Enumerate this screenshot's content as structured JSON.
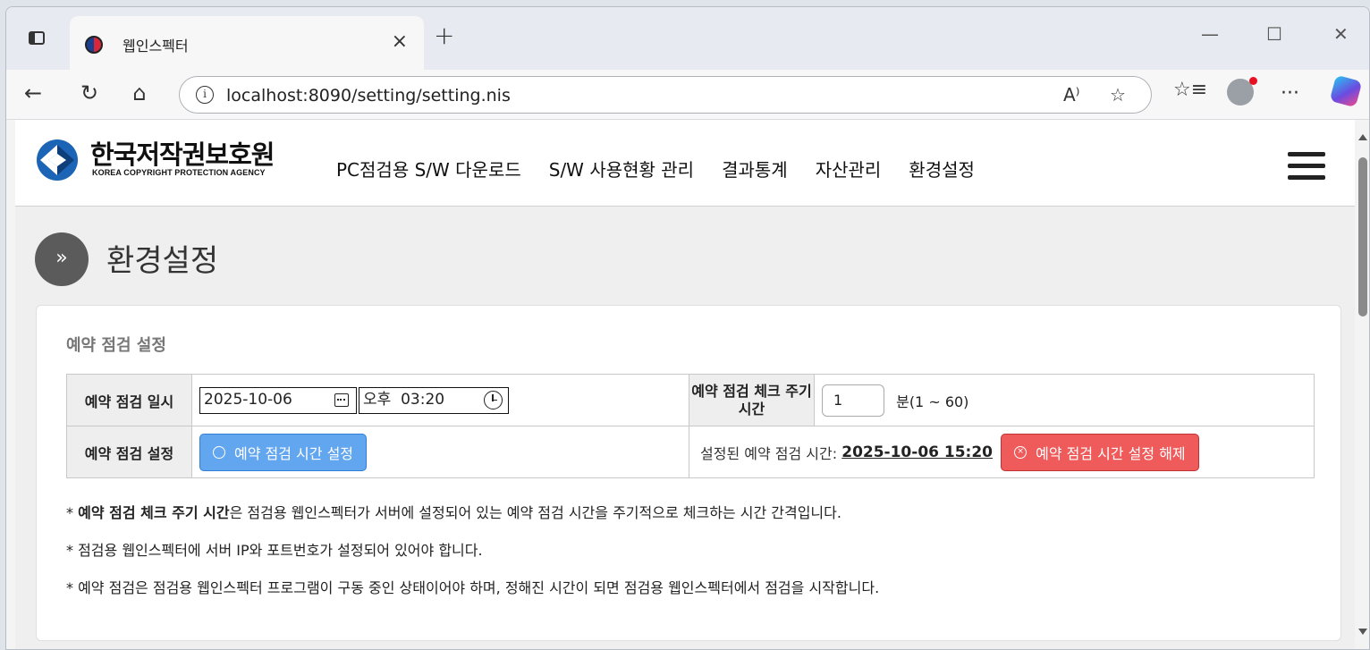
{
  "browser": {
    "tab_title": "웹인스펙터",
    "tab_close": "×",
    "new_tab": "+",
    "url": "localhost:8090/setting/setting.nis",
    "minimize": "—",
    "maximize": "☐",
    "close": "✕",
    "back": "←",
    "reload": "↻",
    "home": "⌂",
    "read_aloud": "A⁾",
    "favorite": "☆",
    "favorites_list": "☆≡",
    "more": "···"
  },
  "site": {
    "logo_ko": "한국저작권보호원",
    "logo_en": "KOREA COPYRIGHT PROTECTION AGENCY",
    "nav": [
      "PC점검용 S/W 다운로드",
      "S/W 사용현황 관리",
      "결과통계",
      "자산관리",
      "환경설정"
    ]
  },
  "page": {
    "title_icon": "»",
    "title": "환경설정"
  },
  "schedule": {
    "section_title": "예약 점검 설정",
    "row1_label": "예약 점검 일시",
    "date_value": "2025-10-06",
    "time_value": "오후  03:20",
    "interval_label": "예약 점검 체크 주기 시간",
    "interval_value": "1",
    "interval_unit": "분(1 ~ 60)",
    "row2_label": "예약 점검 설정",
    "set_button": "예약 점검 시간 설정",
    "current_label": "설정된 예약 점검 시간:",
    "current_value": "2025-10-06 15:20",
    "clear_button": "예약 점검 시간 설정 해제"
  },
  "notes": {
    "note1_prefix": "* ",
    "note1_bold": "예약 점검 체크 주기 시간",
    "note1_rest": "은 점검용 웹인스펙터가 서버에 설정되어 있는 예약 점검 시간을 주기적으로 체크하는 시간 간격입니다.",
    "note2": "* 점검용 웹인스펙터에 서버 IP와 포트번호가 설정되어 있어야 합니다.",
    "note3": "* 예약 점검은 점검용 웹인스펙터 프로그램이 구동 중인 상태이어야 하며, 정해진 시간이 되면 점검용 웹인스펙터에서 점검을 시작합니다."
  },
  "colors": {
    "blue_button": "#63a6f0",
    "red_button": "#ef5a5a",
    "title_icon_bg": "#5b5b5b"
  }
}
